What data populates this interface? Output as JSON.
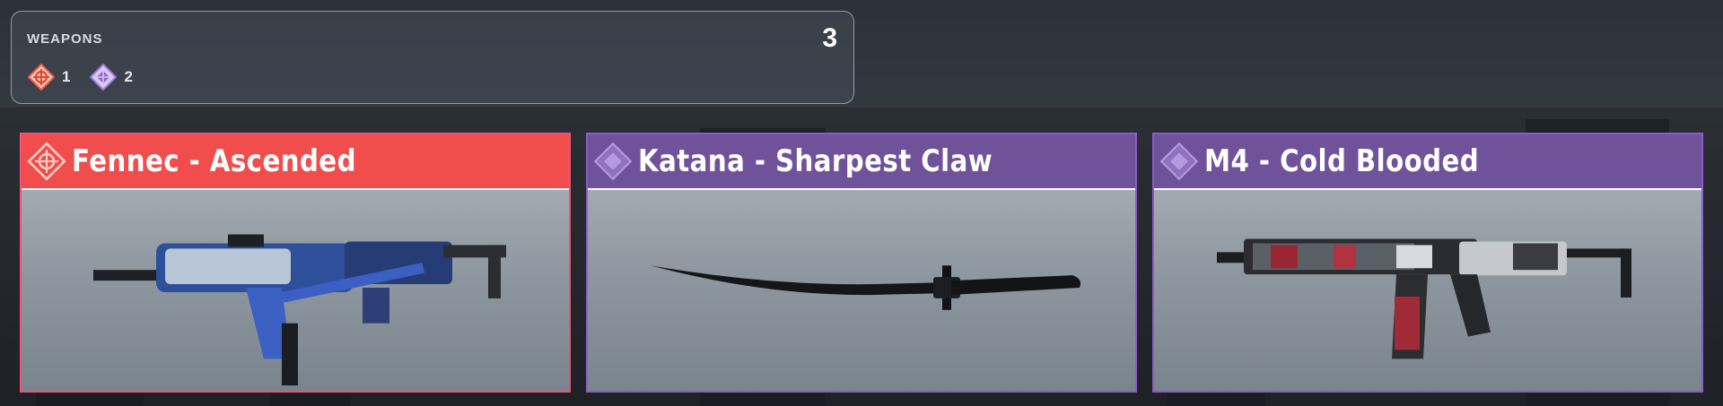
{
  "summary": {
    "title": "WEAPONS",
    "total": "3",
    "rarities": [
      {
        "icon": "legendary-rarity-icon",
        "count": "1",
        "color": "#f05a4a"
      },
      {
        "icon": "epic-rarity-icon",
        "count": "2",
        "color": "#9b7ad6"
      }
    ]
  },
  "cards": [
    {
      "name": "Fennec - Ascended",
      "rarity": "legendary",
      "icon": "legendary-rarity-icon",
      "header_color": "#f24d4d",
      "border_color": "#f0527a",
      "art": "smg-fennec-image"
    },
    {
      "name": "Katana - Sharpest Claw",
      "rarity": "epic",
      "icon": "epic-rarity-icon",
      "header_color": "#70529a",
      "border_color": "#8a5cc8",
      "art": "katana-image"
    },
    {
      "name": "M4 - Cold Blooded",
      "rarity": "epic",
      "icon": "epic-rarity-icon",
      "header_color": "#70529a",
      "border_color": "#8a5cc8",
      "art": "assault-rifle-m4-image"
    }
  ]
}
